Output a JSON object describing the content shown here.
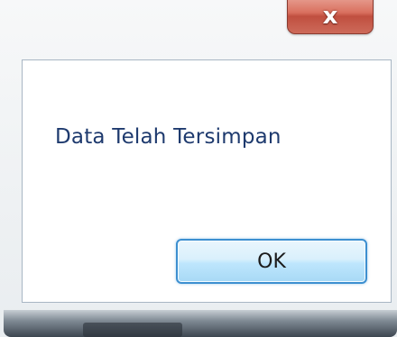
{
  "window": {
    "close_button": {
      "icon": "close-icon",
      "glyph": "x"
    }
  },
  "dialog": {
    "message": "Data Telah Tersimpan",
    "ok_label": "OK"
  },
  "colors": {
    "message_text": "#1e3a6e",
    "ok_border": "#3c8fd0",
    "close_red": "#c04f3f"
  }
}
